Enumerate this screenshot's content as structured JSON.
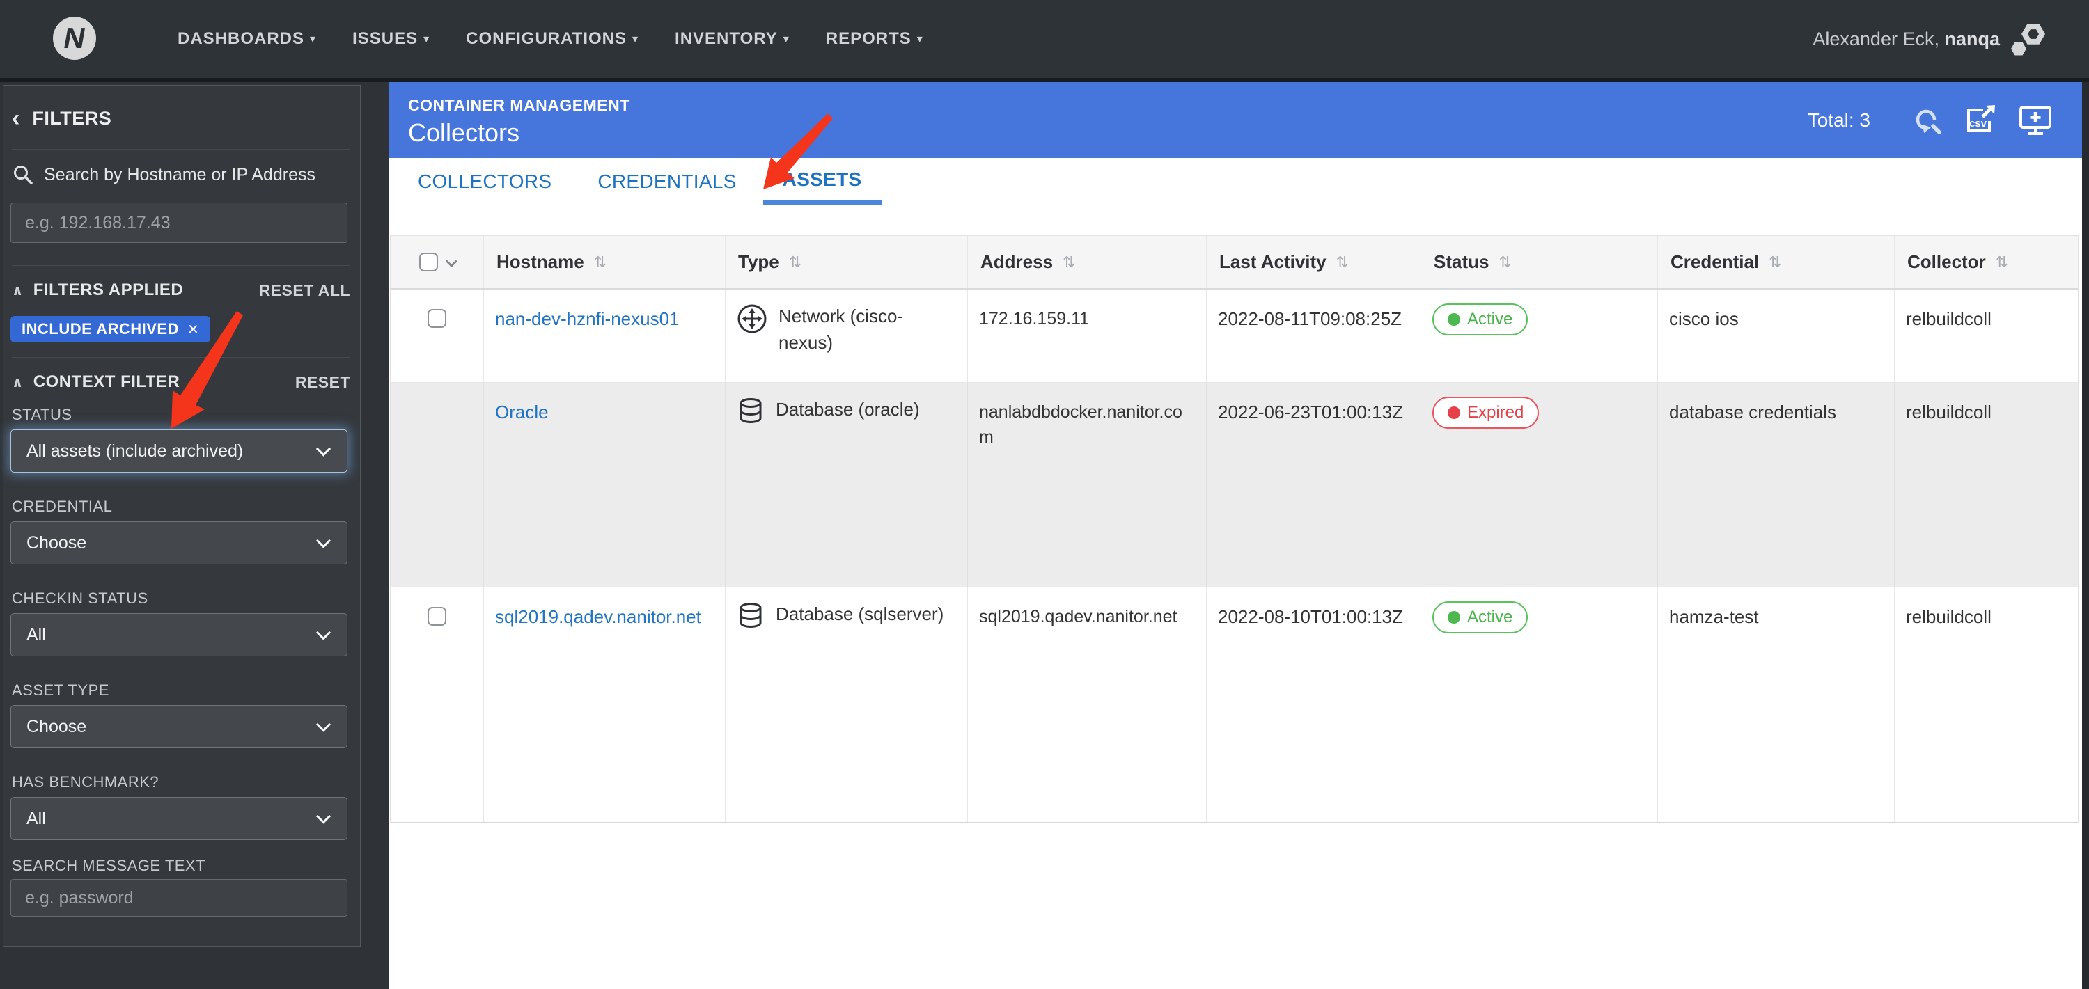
{
  "nav": {
    "logo": "N",
    "items": [
      {
        "label": "DASHBOARDS"
      },
      {
        "label": "ISSUES"
      },
      {
        "label": "CONFIGURATIONS"
      },
      {
        "label": "INVENTORY"
      },
      {
        "label": "REPORTS"
      }
    ],
    "user_prefix": "Alexander Eck,",
    "org": "nanqa"
  },
  "sidebar": {
    "title": "FILTERS",
    "search_label": "Search by Hostname or IP Address",
    "search_placeholder": "e.g. 192.168.17.43",
    "filters_applied": {
      "title": "FILTERS APPLIED",
      "reset": "RESET ALL",
      "chip": "INCLUDE ARCHIVED"
    },
    "context_filter": {
      "title": "CONTEXT FILTER",
      "reset": "RESET"
    },
    "fields": [
      {
        "label": "STATUS",
        "type": "select",
        "value": "All assets (include archived)",
        "highlighted": true
      },
      {
        "label": "CREDENTIAL",
        "type": "select",
        "value": "Choose"
      },
      {
        "label": "CHECKIN STATUS",
        "type": "select",
        "value": "All"
      },
      {
        "label": "ASSET TYPE",
        "type": "select",
        "value": "Choose"
      },
      {
        "label": "HAS BENCHMARK?",
        "type": "select",
        "value": "All"
      },
      {
        "label": "SEARCH MESSAGE TEXT",
        "type": "input",
        "placeholder": "e.g. password"
      }
    ]
  },
  "header": {
    "breadcrumb": "CONTAINER MANAGEMENT",
    "title": "Collectors",
    "total_label": "Total: 3"
  },
  "tabs": [
    {
      "label": "COLLECTORS",
      "active": false
    },
    {
      "label": "CREDENTIALS",
      "active": false
    },
    {
      "label": "ASSETS",
      "active": true
    }
  ],
  "table": {
    "columns": [
      "Hostname",
      "Type",
      "Address",
      "Last Activity",
      "Status",
      "Credential",
      "Collector"
    ],
    "rows": [
      {
        "hostname": "nan-dev-hznfi-nexus01",
        "type": "Network (cisco-nexus)",
        "type_icon": "network",
        "address": "172.16.159.11",
        "last_activity": "2022-08-11T09:08:25Z",
        "status": "Active",
        "credential": "cisco ios",
        "collector": "relbuildcoll",
        "has_checkbox": true,
        "archived": false
      },
      {
        "hostname": "Oracle",
        "type": "Database (oracle)",
        "type_icon": "database",
        "address": "nanlabdbdocker.nanitor.com",
        "last_activity": "2022-06-23T01:00:13Z",
        "status": "Expired",
        "credential": "database credentials",
        "collector": "relbuildcoll",
        "has_checkbox": false,
        "archived": true
      },
      {
        "hostname": "sql2019.qadev.nanitor.net",
        "type": "Database (sqlserver)",
        "type_icon": "database",
        "address": "sql2019.qadev.nanitor.net",
        "last_activity": "2022-08-10T01:00:13Z",
        "status": "Active",
        "credential": "hamza-test",
        "collector": "relbuildcoll",
        "has_checkbox": true,
        "archived": false
      }
    ]
  },
  "icons": {
    "caret_down": "▾",
    "sort": "⇅",
    "close": "✕",
    "back": "‹",
    "collapse": "∧"
  },
  "colors": {
    "accent_header": "#4676db",
    "chip_blue": "#3468d4",
    "status_active": "#4db84f",
    "status_expired": "#e5404a",
    "link_blue": "#2173c5",
    "annotation_arrow_red": "#f5351b"
  }
}
